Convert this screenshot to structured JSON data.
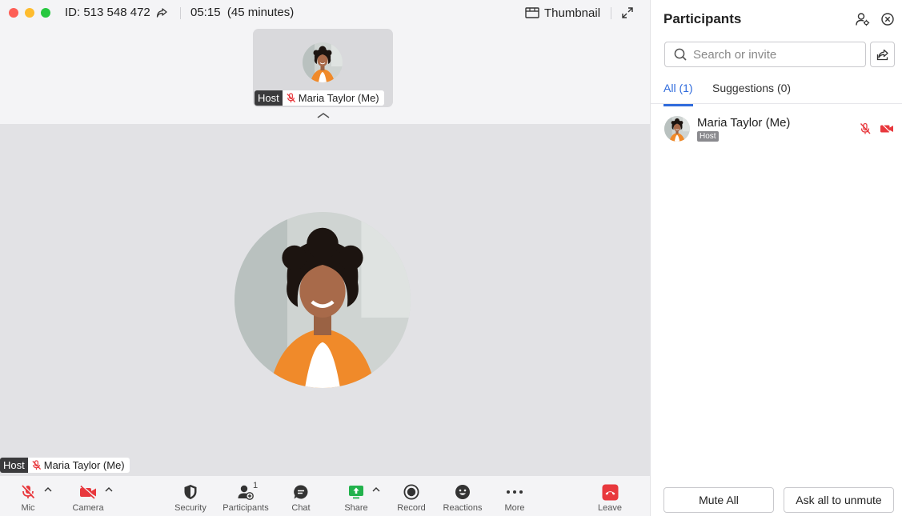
{
  "topbar": {
    "meeting_id": "ID: 513 548 472",
    "timer": "05:15",
    "duration": "(45 minutes)",
    "view_mode_label": "Thumbnail"
  },
  "thumbnail": {
    "host_label": "Host",
    "name": "Maria Taylor (Me)"
  },
  "stage": {
    "host_label": "Host",
    "name": "Maria Taylor (Me)"
  },
  "toolbar": {
    "mic_label": "Mic",
    "camera_label": "Camera",
    "security_label": "Security",
    "participants_label": "Participants",
    "participants_count": "1",
    "chat_label": "Chat",
    "share_label": "Share",
    "record_label": "Record",
    "reactions_label": "Reactions",
    "more_label": "More",
    "leave_label": "Leave"
  },
  "panel": {
    "title": "Participants",
    "search_placeholder": "Search or invite",
    "tabs": [
      {
        "label": "All (1)",
        "active": true
      },
      {
        "label": "Suggestions (0)",
        "active": false
      }
    ],
    "participants": [
      {
        "name": "Maria Taylor (Me)",
        "role": "Host",
        "mic": "muted",
        "camera": "off"
      }
    ],
    "mute_all_label": "Mute All",
    "ask_unmute_label": "Ask all to unmute"
  },
  "colors": {
    "accent": "#2f6bdc",
    "danger": "#e8383d",
    "share_green": "#22b24c"
  }
}
